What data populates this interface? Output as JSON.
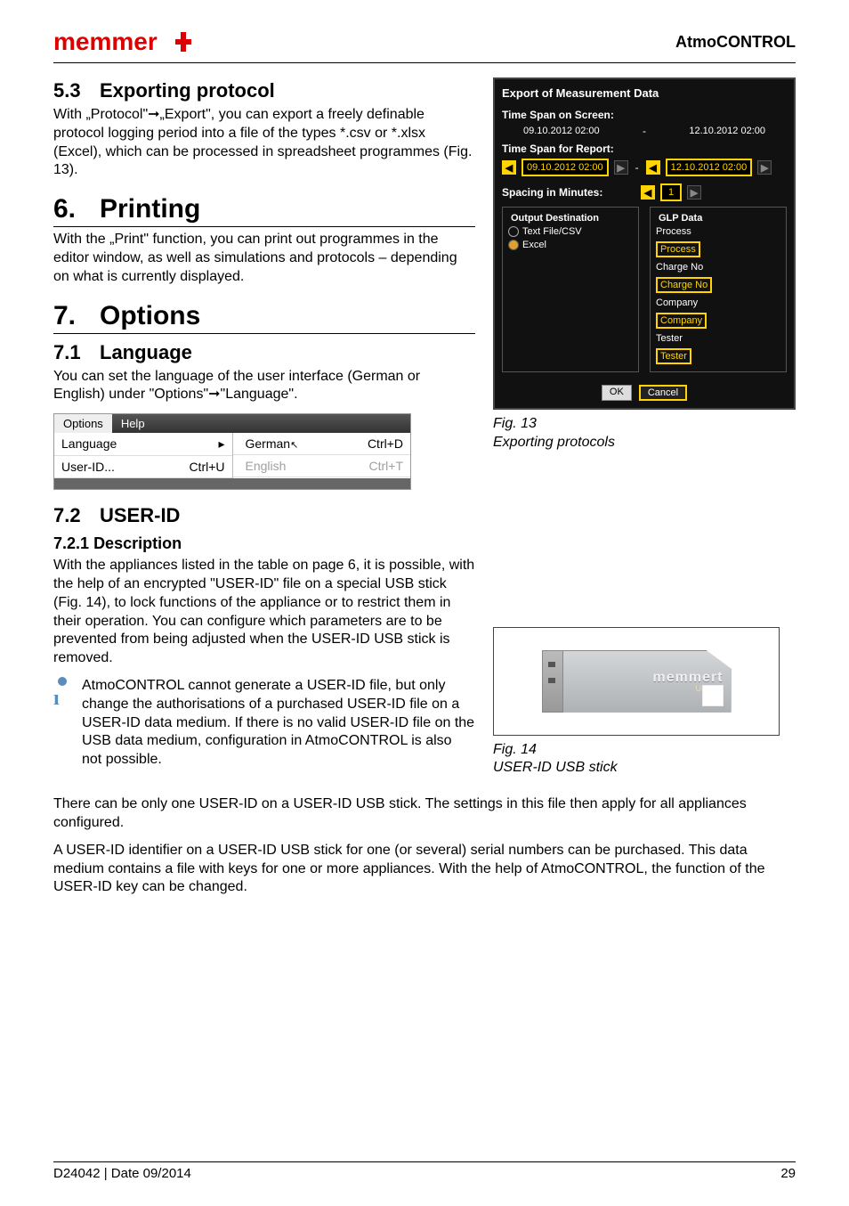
{
  "header": {
    "logo_text": "memmert",
    "right": "AtmoCONTROL"
  },
  "sec53": {
    "num": "5.3",
    "title": "Exporting protocol",
    "body": "With „Protocol\"➞„Export\", you can export a freely definable protocol logging period into a file of the types *.csv or *.xlsx (Excel), which can be processed in spreadsheet programmes (Fig. 13)."
  },
  "sec6": {
    "num": "6.",
    "title": "Printing",
    "body": "With the „Print\" function, you can print out programmes in the editor window, as well as simulations and protocols – depending on what is currently displayed."
  },
  "sec7": {
    "num": "7.",
    "title": "Options"
  },
  "sec71": {
    "num": "7.1",
    "title": "Language",
    "body": "You can set the language of the user interface (German or English) under \"Options\"➞\"Language\"."
  },
  "menu": {
    "options": "Options",
    "help": "Help",
    "language": "Language",
    "user_id": "User-ID...",
    "user_id_shortcut": "Ctrl+U",
    "german": "German",
    "german_shortcut": "Ctrl+D",
    "english": "English",
    "english_shortcut": "Ctrl+T"
  },
  "sec72": {
    "num": "7.2",
    "title": "USER-ID"
  },
  "sec721": {
    "num": "7.2.1",
    "title": "Description",
    "body": "With the appliances listed in the table on page 6, it is possible, with the help of an encrypted \"USER-ID\" file on a special USB stick (Fig. 14), to lock functions of the appliance or to restrict them in their operation. You can configure which parameters are to be prevented from being adjusted when the USER-ID USB stick is removed.",
    "note": "AtmoCONTROL cannot generate a USER-ID file, but only change the authorisations of a purchased USER-ID file on a USER-ID data medium. If there is no valid USER-ID file on the USB data medium, configuration in AtmoCONTROL is also not possible.",
    "p2": "There can be only one USER-ID on a USER-ID USB stick. The settings in this file then apply for all appliances configured.",
    "p3": "A USER-ID identifier on a USER-ID USB stick for one (or several) serial numbers can be purchased. This data medium contains a file with keys for one or more appliances. With the help of AtmoCONTROL, the function of the USER-ID key can be changed."
  },
  "export_dialog": {
    "title": "Export of Measurement Data",
    "time_span_screen_label": "Time Span on Screen:",
    "screen_start": "09.10.2012 02:00",
    "screen_sep": "-",
    "screen_end": "12.10.2012 02:00",
    "time_span_report_label": "Time Span for Report:",
    "report_start": "09.10.2012 02:00",
    "report_end": "12.10.2012 02:00",
    "spacing_label": "Spacing in Minutes:",
    "spacing_value": "1",
    "output_dest_legend": "Output Destination",
    "output_text": "Text File/CSV",
    "output_excel": "Excel",
    "glp_legend": "GLP Data",
    "glp_process_lbl": "Process",
    "glp_process_val": "Process",
    "glp_charge_lbl": "Charge No",
    "glp_charge_val": "Charge No",
    "glp_company_lbl": "Company",
    "glp_company_val": "Company",
    "glp_tester_lbl": "Tester",
    "glp_tester_val": "Tester",
    "ok": "OK",
    "cancel": "Cancel"
  },
  "fig13": {
    "num": "Fig. 13",
    "caption": "Exporting protocols"
  },
  "fig14": {
    "num": "Fig. 14",
    "caption": "USER-ID USB stick",
    "usb_brand": "memmert",
    "usb_sub": "User-ID"
  },
  "footer": {
    "left": "D24042 | Date 09/2014",
    "right": "29"
  }
}
